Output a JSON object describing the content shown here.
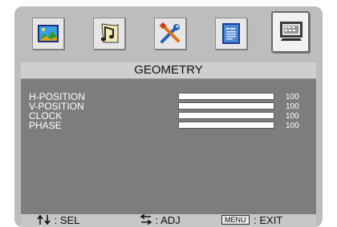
{
  "tabs": [
    {
      "name": "picture-tab",
      "icon": "landscape-picture-icon"
    },
    {
      "name": "audio-tab",
      "icon": "music-note-icon"
    },
    {
      "name": "tools-tab",
      "icon": "screwdriver-wrench-icon"
    },
    {
      "name": "information-tab",
      "icon": "document-icon"
    },
    {
      "name": "geometry-tab",
      "icon": "monitor-icon",
      "active": true
    }
  ],
  "menu": {
    "title": "GEOMETRY",
    "items": [
      {
        "label": "H-POSITION",
        "value": "100",
        "level": 1.0
      },
      {
        "label": "V-POSITION",
        "value": "100",
        "level": 1.0
      },
      {
        "label": "CLOCK",
        "value": "100",
        "level": 1.0
      },
      {
        "label": "PHASE",
        "value": "100",
        "level": 1.0
      }
    ]
  },
  "hints": {
    "sel_label": ": SEL",
    "adj_label": ": ADJ",
    "menu_key": "MENU",
    "exit_label": ": EXIT"
  },
  "colors": {
    "background": "#bdbdbd",
    "panel": "#7d7d7d",
    "title_bar": "#cfcfcf",
    "text_light": "#ffffff"
  }
}
